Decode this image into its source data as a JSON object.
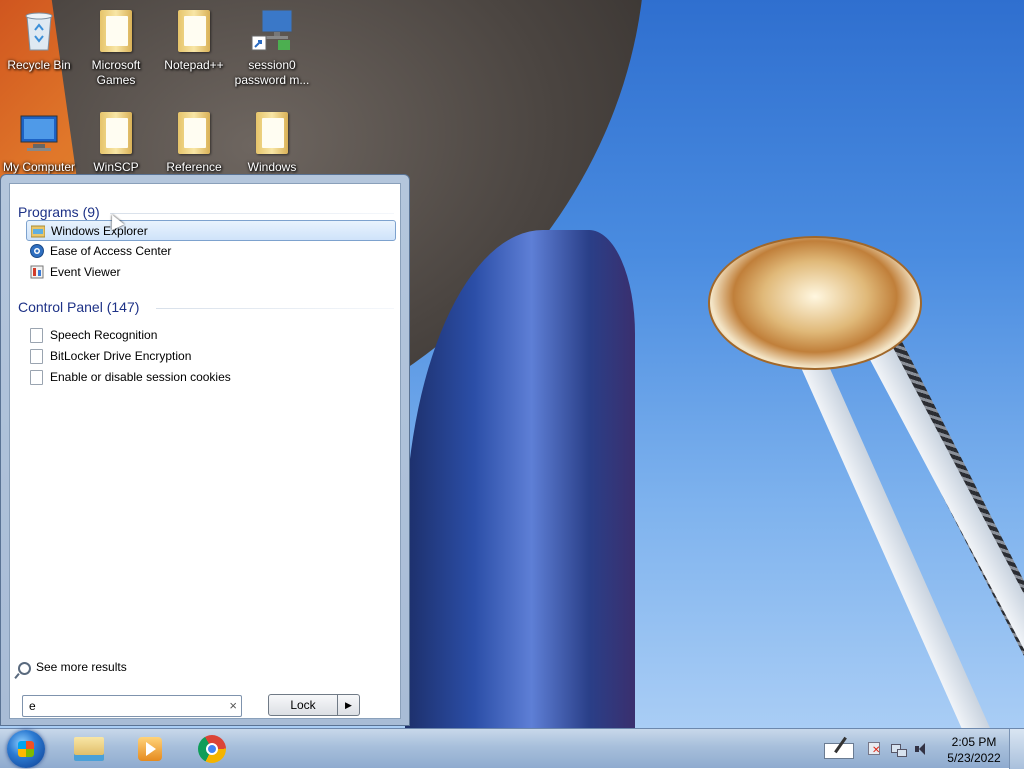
{
  "desktop": {
    "icons": [
      {
        "label": "Recycle Bin",
        "icon": "recycle-bin-icon"
      },
      {
        "label": "Microsoft Games",
        "icon": "folder-icon"
      },
      {
        "label": "Notepad++",
        "icon": "folder-icon"
      },
      {
        "label": "session0 password m...",
        "icon": "shortcut-icon"
      },
      {
        "label": "My Computer",
        "icon": "computer-icon"
      },
      {
        "label": "WinSCP",
        "icon": "folder-icon"
      },
      {
        "label": "Reference",
        "icon": "folder-icon"
      },
      {
        "label": "Windows",
        "icon": "folder-icon"
      }
    ]
  },
  "start_menu": {
    "programs_header": "Programs (9)",
    "programs": [
      {
        "label": "Windows Explorer",
        "icon": "explorer-folder-icon",
        "selected": true
      },
      {
        "label": "Ease of Access Center",
        "icon": "ease-of-access-icon"
      },
      {
        "label": "Event Viewer",
        "icon": "event-viewer-icon"
      }
    ],
    "control_panel_header": "Control Panel (147)",
    "control_panel": [
      {
        "label": "Speech Recognition",
        "icon": "page-icon"
      },
      {
        "label": "BitLocker Drive Encryption",
        "icon": "page-icon"
      },
      {
        "label": "Enable or disable session cookies",
        "icon": "page-icon"
      }
    ],
    "see_more": "See more results",
    "search_value": "e",
    "search_clear": "×",
    "lock_label": "Lock",
    "lock_arrow": "▶"
  },
  "taskbar": {
    "pinned": [
      {
        "name": "windows-explorer",
        "icon": "folder-icon"
      },
      {
        "name": "windows-media-player",
        "icon": "media-player-icon"
      },
      {
        "name": "google-chrome",
        "icon": "chrome-icon"
      }
    ],
    "clock_time": "2:05 PM",
    "clock_date": "5/23/2022"
  },
  "colors": {
    "accent": "#1e3287",
    "selection_border": "#7da2ce",
    "taskbar": "#a7bfdb"
  }
}
